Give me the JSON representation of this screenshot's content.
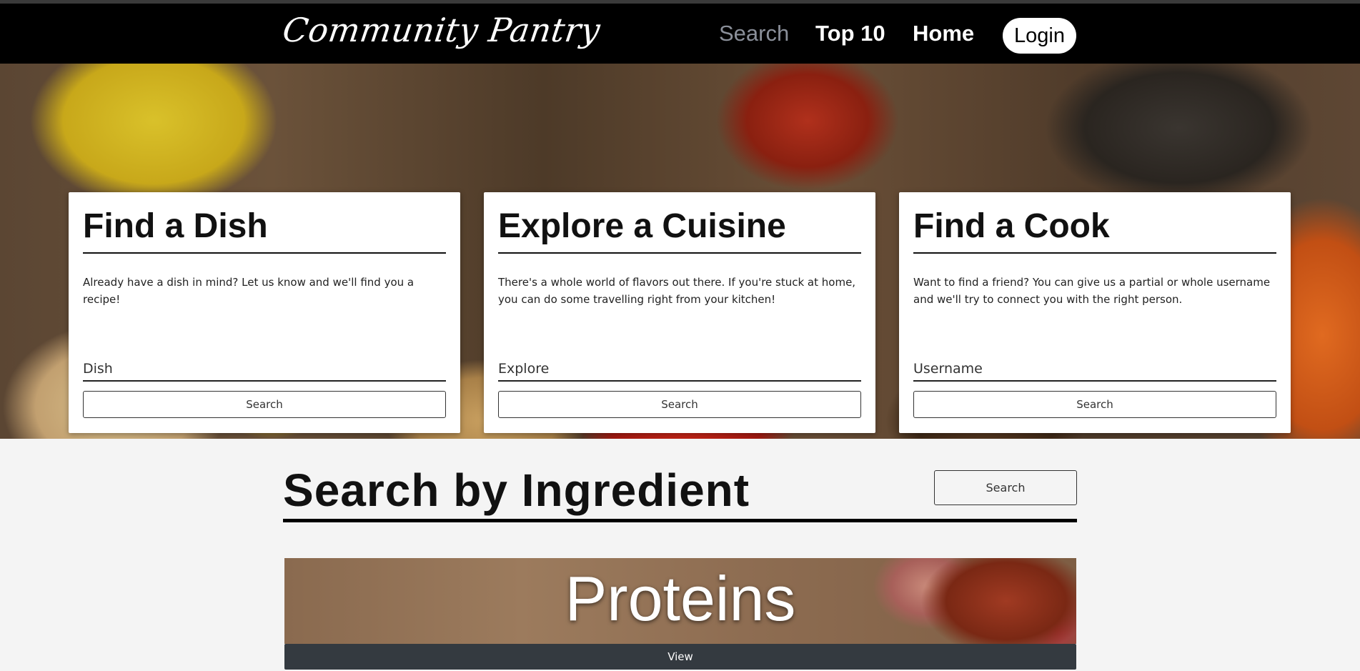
{
  "nav": {
    "brand": "Community Pantry",
    "links": {
      "search": "Search",
      "top10": "Top 10",
      "home": "Home"
    },
    "login": "Login"
  },
  "cards": [
    {
      "title": "Find a Dish",
      "description": "Already have a dish in mind? Let us know and we'll find you a recipe!",
      "placeholder": "Dish",
      "button": "Search"
    },
    {
      "title": "Explore a Cuisine",
      "description": "There's a whole world of flavors out there. If you're stuck at home, you can do some travelling right from your kitchen!",
      "placeholder": "Explore",
      "button": "Search"
    },
    {
      "title": "Find a Cook",
      "description": "Want to find a friend? You can give us a partial or whole username and we'll try to connect you with the right person.",
      "placeholder": "Username",
      "button": "Search"
    }
  ],
  "ingredients": {
    "title": "Search by Ingredient",
    "search_button": "Search",
    "categories": [
      {
        "label": "Proteins",
        "button": "View"
      }
    ]
  }
}
